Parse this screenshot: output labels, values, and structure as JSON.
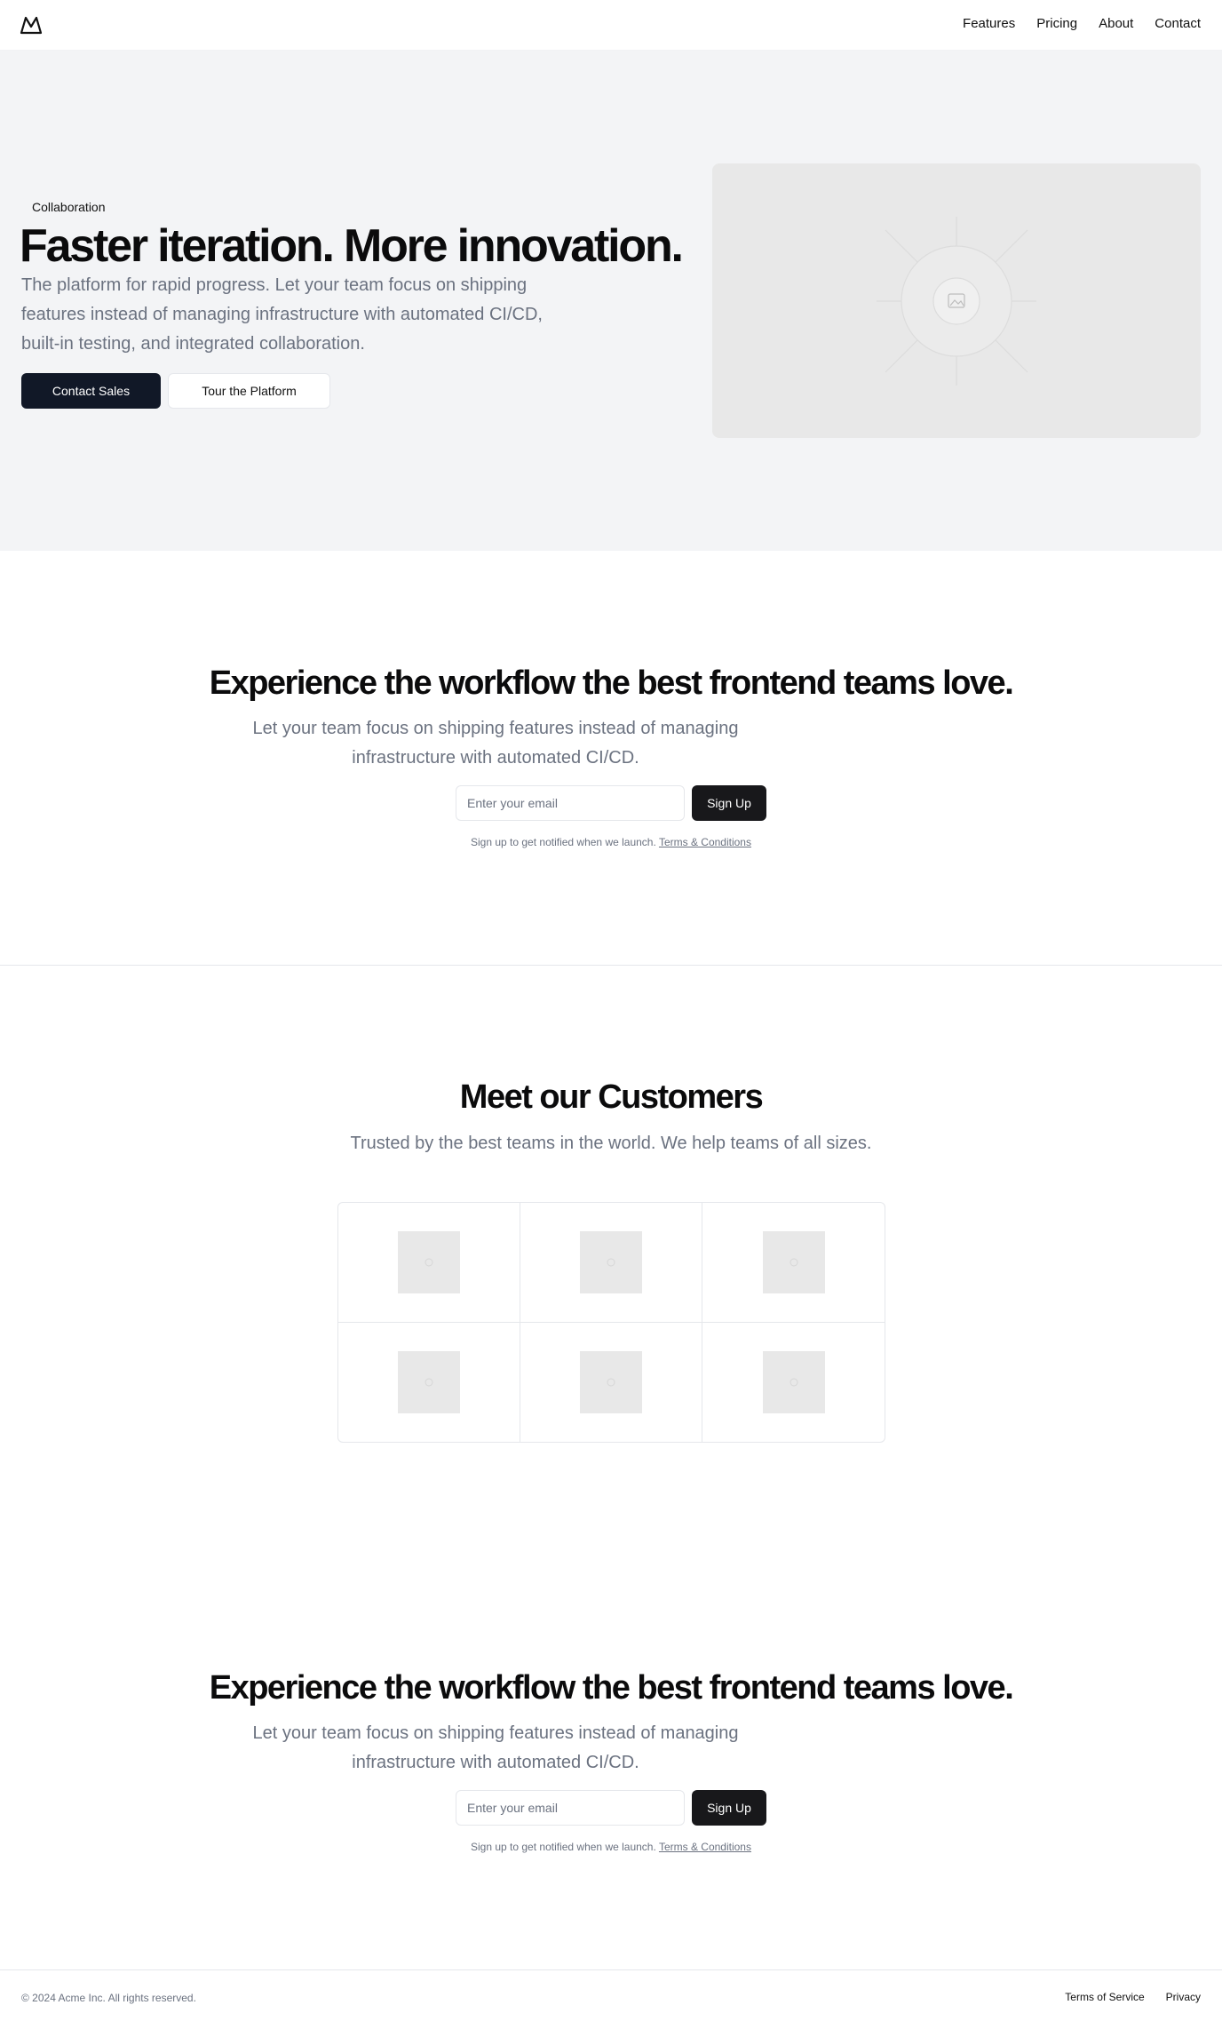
{
  "nav": {
    "logo_icon": "mountain-icon",
    "links": [
      "Features",
      "Pricing",
      "About",
      "Contact"
    ]
  },
  "hero": {
    "badge": "Collaboration",
    "title": "Faster iteration. More innovation.",
    "description": "The platform for rapid progress. Let your team focus on shipping features instead of managing infrastructure with automated CI/CD, built-in testing, and integrated collaboration.",
    "primary_button": "Contact Sales",
    "secondary_button": "Tour the Platform",
    "image_icon": "image-placeholder-icon"
  },
  "cta1": {
    "title": "Experience the workflow the best frontend teams love.",
    "description": "Let your team focus on shipping features instead of managing infrastructure with automated CI/CD.",
    "email_placeholder": "Enter your email",
    "button": "Sign Up",
    "note": "Sign up to get notified when we launch.",
    "note_link": "Terms & Conditions"
  },
  "customers": {
    "title": "Meet our Customers",
    "description": "Trusted by the best teams in the world. We help teams of all sizes.",
    "logo_icon": "logo-placeholder-icon"
  },
  "cta2": {
    "title": "Experience the workflow the best frontend teams love.",
    "description": "Let your team focus on shipping features instead of managing infrastructure with automated CI/CD.",
    "email_placeholder": "Enter your email",
    "button": "Sign Up",
    "note": "Sign up to get notified when we launch.",
    "note_link": "Terms & Conditions"
  },
  "footer": {
    "copyright": "© 2024 Acme Inc. All rights reserved.",
    "links": [
      "Terms of Service",
      "Privacy"
    ]
  }
}
